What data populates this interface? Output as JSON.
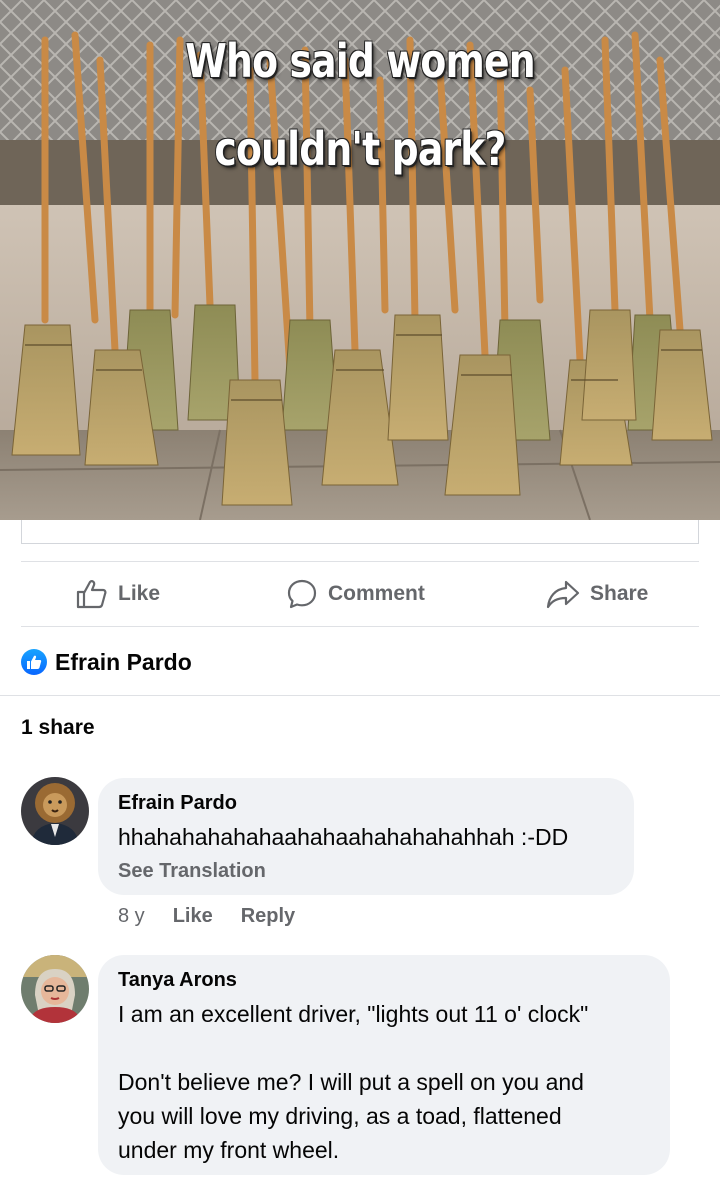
{
  "post": {
    "caption_line1": "Who said women",
    "caption_line2": "couldn't park?"
  },
  "actions": {
    "like": "Like",
    "comment": "Comment",
    "share": "Share"
  },
  "reactions": {
    "name": "Efrain Pardo"
  },
  "shares": {
    "label": "1 share"
  },
  "comments": [
    {
      "author": "Efrain Pardo",
      "text": "hhahahahahahaahahaahahahahahhah :-DD",
      "translation": "See Translation",
      "age": "8 y",
      "like": "Like",
      "reply": "Reply"
    },
    {
      "author": "Tanya Arons",
      "text_lines": [
        "I am an excellent driver, \"lights out 11 o' clock\"",
        "",
        "Don't believe me?  I will put a spell on you and",
        "you will love my driving, as a toad, flattened",
        "under my front wheel."
      ]
    }
  ],
  "colors": {
    "accent": "#0866ff",
    "secondary_text": "#65676b",
    "bubble": "#f0f2f5"
  }
}
